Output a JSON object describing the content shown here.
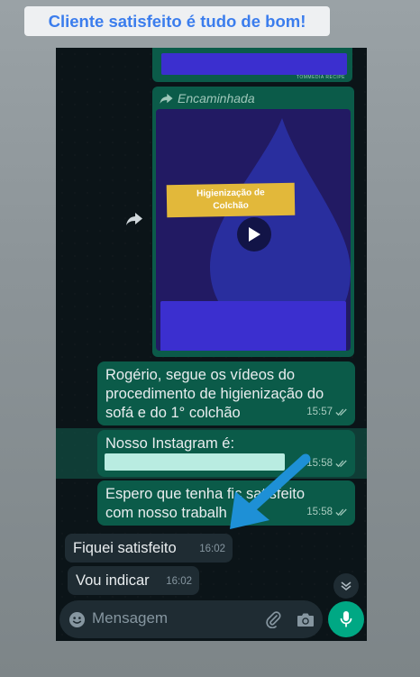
{
  "story": {
    "caption": "Cliente satisfeito é tudo de bom!"
  },
  "chat": {
    "top_media_tiny": "TOMMEDIA RECIPE",
    "forwarded_label": "Encaminhada",
    "video_thumb_text_line1": "Higienização de",
    "video_thumb_text_line2": "Colchão",
    "messages": [
      {
        "text": "Rogério, segue os vídeos do procedimento de higienização do sofá e do 1° colchão",
        "time": "15:57"
      },
      {
        "text": "Nosso Instagram é:",
        "time": "15:58"
      },
      {
        "text_part1": "Espero que tenha fic",
        "text_part2": "satisfeito",
        "text_part3": "com nosso trabalh",
        "time": "15:58"
      },
      {
        "text": "Fiquei satisfeito",
        "time": "16:02"
      },
      {
        "text": "Vou indicar",
        "time": "16:02"
      }
    ]
  },
  "composer": {
    "placeholder": "Mensagem"
  },
  "colors": {
    "outgoing_bubble": "#0b5b49",
    "incoming_bubble": "#1f2c33",
    "accent_green": "#00a884",
    "arrow_blue": "#1e90d6",
    "caption_blue": "#3b7ded"
  }
}
